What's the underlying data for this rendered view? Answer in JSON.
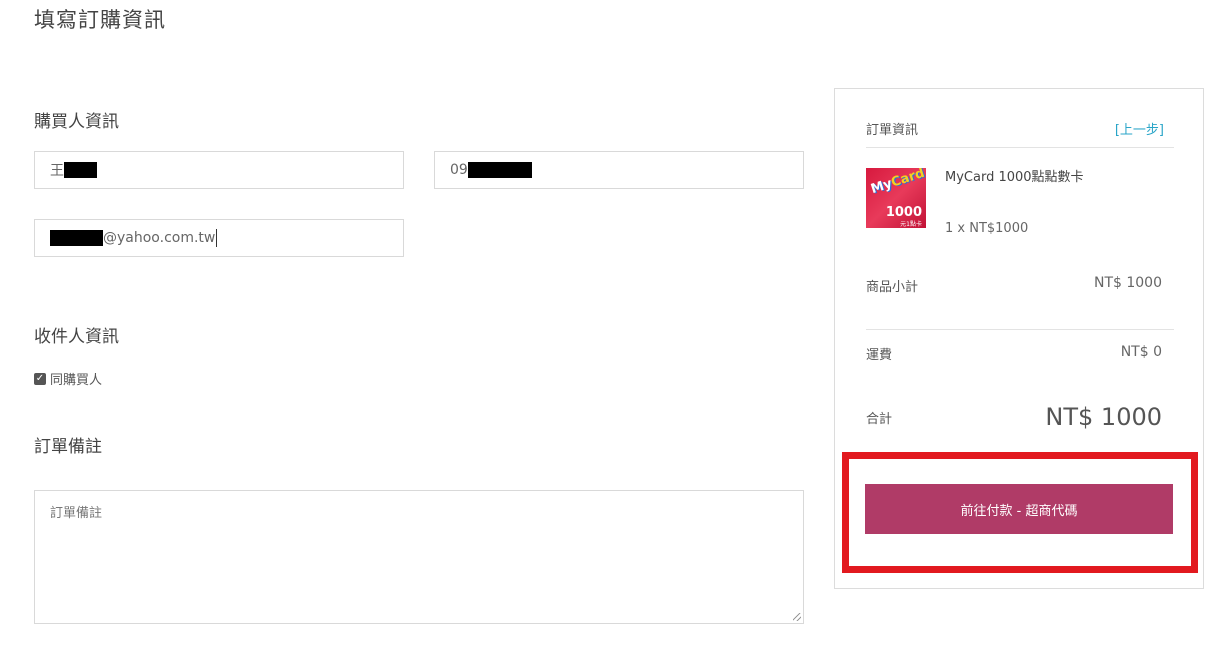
{
  "page_title": "填寫訂購資訊",
  "buyer": {
    "section_title": "購買人資訊",
    "name_value": "王",
    "phone_value": "09",
    "email_value": "@yahoo.com.tw"
  },
  "recipient": {
    "section_title": "收件人資訊",
    "same_as_buyer_label": "同購買人",
    "same_as_buyer_checked": true
  },
  "notes": {
    "section_title": "訂單備註",
    "placeholder": "訂單備註"
  },
  "summary": {
    "title": "訂單資訊",
    "back_link": "[上一步]",
    "product": {
      "name": "MyCard 1000點點數卡",
      "quantity_price": "1 x NT$1000",
      "image_text": {
        "logo": "MyCard",
        "amount": "1000",
        "sub": "元1點卡"
      }
    },
    "subtotal_label": "商品小計",
    "subtotal_value": "NT$ 1000",
    "shipping_label": "運費",
    "shipping_value": "NT$ 0",
    "total_label": "合計",
    "total_value": "NT$ 1000",
    "pay_button": "前往付款 - 超商代碼"
  },
  "colors": {
    "pay_button": "#b03b67",
    "highlight_border": "#e2191f",
    "link": "#2aa5c8"
  }
}
